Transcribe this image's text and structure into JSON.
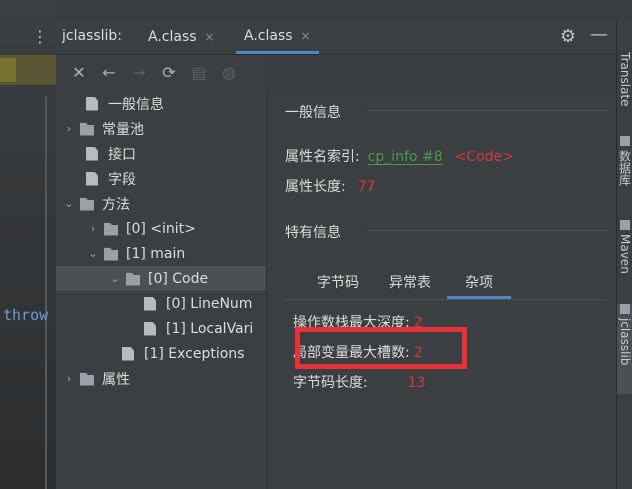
{
  "editor": {
    "dots": "⋮",
    "code_fragment": "throw"
  },
  "header": {
    "tool_title": "jclasslib:",
    "tabs": [
      {
        "label": "A.class",
        "close": "×"
      },
      {
        "label": "A.class",
        "close": "×"
      }
    ],
    "gear": "⚙",
    "minimize": "—"
  },
  "toolbar": {
    "close": "✕",
    "back": "←",
    "forward": "→",
    "refresh": "⟳",
    "save": "▤",
    "browser": "◍"
  },
  "tree": {
    "rows": [
      {
        "label": "一般信息",
        "chev": "",
        "icon": "file"
      },
      {
        "label": "常量池",
        "chev": "›",
        "icon": "folder"
      },
      {
        "label": "接口",
        "chev": "",
        "icon": "file"
      },
      {
        "label": "字段",
        "chev": "",
        "icon": "file"
      },
      {
        "label": "方法",
        "chev": "⌄",
        "icon": "folder"
      },
      {
        "label": "[0] <init>",
        "chev": "›",
        "icon": "folder"
      },
      {
        "label": "[1] main",
        "chev": "⌄",
        "icon": "folder"
      },
      {
        "label": "[0] Code",
        "chev": "⌄",
        "icon": "folder"
      },
      {
        "label": "[0] LineNum",
        "chev": "",
        "icon": "file"
      },
      {
        "label": "[1] LocalVari",
        "chev": "",
        "icon": "file"
      },
      {
        "label": "[1] Exceptions",
        "chev": "",
        "icon": "file"
      },
      {
        "label": "属性",
        "chev": "›",
        "icon": "folder"
      }
    ]
  },
  "content": {
    "general_title": "一般信息",
    "name_index_label": "属性名索引:",
    "name_index_link": "cp_info #8",
    "name_index_value": "<Code>",
    "length_label": "属性长度:",
    "length_value": "77",
    "specific_title": "特有信息",
    "subtabs": [
      "字节码",
      "异常表",
      "杂项"
    ],
    "misc": [
      {
        "label": "操作数栈最大深度:",
        "value": "2"
      },
      {
        "label": "局部变量最大槽数:",
        "value": "2"
      },
      {
        "label": "字节码长度:",
        "value": "13"
      }
    ]
  },
  "right_bar": {
    "tabs": [
      "Translate",
      "数据库",
      "Maven",
      "jclasslib"
    ]
  },
  "colors": {
    "link_green": "#4d9a4d",
    "value_red": "#d73a3a",
    "tab_accent": "#4a88c7",
    "highlight_box": "#e8323a"
  }
}
